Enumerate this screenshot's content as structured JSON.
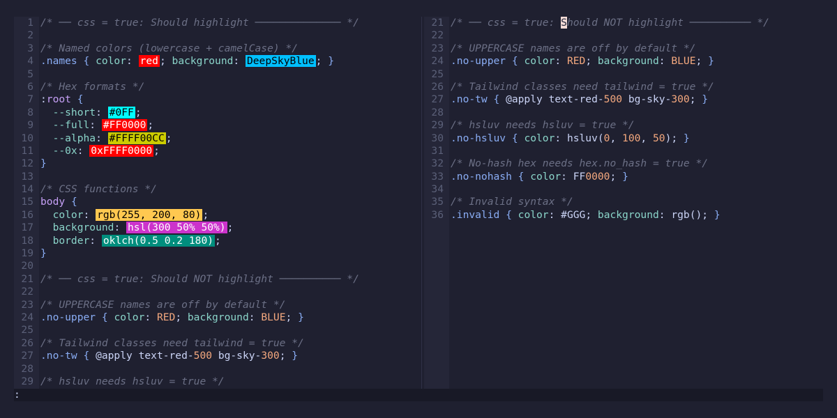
{
  "statusbar": {
    "text": ":"
  },
  "colors": {
    "red": "#ff0000",
    "deepskyblue": "#00bfff",
    "cyan": "#00ffff",
    "yellow_alpha": "#cccc00",
    "rgb_swatch": "#ffc850",
    "hsl_swatch": "#cc33cc",
    "oklch_swatch": "#008e7d"
  },
  "left": [
    {
      "n": "1",
      "segs": [
        {
          "t": "/* ── css = true: Should highlight ────────────── */",
          "c": "cmt"
        }
      ]
    },
    {
      "n": "2",
      "segs": []
    },
    {
      "n": "3",
      "segs": [
        {
          "t": "/* Named colors (lowercase + camelCase) */",
          "c": "cmt"
        }
      ]
    },
    {
      "n": "4",
      "segs": [
        {
          "t": ".names",
          "c": "sel"
        },
        {
          "t": " { ",
          "c": "punc"
        },
        {
          "t": "color",
          "c": "prop"
        },
        {
          "t": ": ",
          "c": "txt"
        },
        {
          "t": "red",
          "sw": "#ff0000",
          "fg": "#ffffff"
        },
        {
          "t": "; ",
          "c": "txt"
        },
        {
          "t": "background",
          "c": "prop"
        },
        {
          "t": ": ",
          "c": "txt"
        },
        {
          "t": "DeepSkyBlue",
          "sw": "#00bfff",
          "fg": "#000000"
        },
        {
          "t": "; ",
          "c": "txt"
        },
        {
          "t": "}",
          "c": "punc"
        }
      ]
    },
    {
      "n": "5",
      "segs": []
    },
    {
      "n": "6",
      "segs": [
        {
          "t": "/* Hex formats */",
          "c": "cmt"
        }
      ]
    },
    {
      "n": "7",
      "segs": [
        {
          "t": ":",
          "c": "txt"
        },
        {
          "t": "root",
          "c": "at"
        },
        {
          "t": " {",
          "c": "punc"
        }
      ]
    },
    {
      "n": "8",
      "segs": [
        {
          "t": "  --short",
          "c": "prop"
        },
        {
          "t": ": ",
          "c": "txt"
        },
        {
          "t": "#0FF",
          "sw": "#00ffff",
          "fg": "#000000"
        },
        {
          "t": ";",
          "c": "txt"
        }
      ]
    },
    {
      "n": "9",
      "segs": [
        {
          "t": "  --full",
          "c": "prop"
        },
        {
          "t": ": ",
          "c": "txt"
        },
        {
          "t": "#FF0000",
          "sw": "#ff0000",
          "fg": "#ffffff"
        },
        {
          "t": ";",
          "c": "txt"
        }
      ]
    },
    {
      "n": "10",
      "segs": [
        {
          "t": "  --alpha",
          "c": "prop"
        },
        {
          "t": ": ",
          "c": "txt"
        },
        {
          "t": "#FFFF00CC",
          "sw": "#cccc00",
          "fg": "#000000"
        },
        {
          "t": ";",
          "c": "txt"
        }
      ]
    },
    {
      "n": "11",
      "segs": [
        {
          "t": "  --0x",
          "c": "prop"
        },
        {
          "t": ": ",
          "c": "txt"
        },
        {
          "t": "0xFFFF0000",
          "sw": "#ff0000",
          "fg": "#ffffff"
        },
        {
          "t": ";",
          "c": "txt"
        }
      ]
    },
    {
      "n": "12",
      "segs": [
        {
          "t": "}",
          "c": "punc"
        }
      ]
    },
    {
      "n": "13",
      "segs": []
    },
    {
      "n": "14",
      "segs": [
        {
          "t": "/* CSS functions */",
          "c": "cmt"
        }
      ]
    },
    {
      "n": "15",
      "segs": [
        {
          "t": "body",
          "c": "at"
        },
        {
          "t": " {",
          "c": "punc"
        }
      ]
    },
    {
      "n": "16",
      "segs": [
        {
          "t": "  color",
          "c": "prop"
        },
        {
          "t": ": ",
          "c": "txt"
        },
        {
          "t": "rgb(255, 200, 80)",
          "sw": "#ffc850",
          "fg": "#000000"
        },
        {
          "t": ";",
          "c": "txt"
        }
      ]
    },
    {
      "n": "17",
      "segs": [
        {
          "t": "  background",
          "c": "prop"
        },
        {
          "t": ": ",
          "c": "txt"
        },
        {
          "t": "hsl(300 50% 50%)",
          "sw": "#cc33cc",
          "fg": "#ffffff"
        },
        {
          "t": ";",
          "c": "txt"
        }
      ]
    },
    {
      "n": "18",
      "segs": [
        {
          "t": "  border",
          "c": "prop"
        },
        {
          "t": ": ",
          "c": "txt"
        },
        {
          "t": "oklch(0.5 0.2 180)",
          "sw": "#008e7d",
          "fg": "#ffffff"
        },
        {
          "t": ";",
          "c": "txt"
        }
      ]
    },
    {
      "n": "19",
      "segs": [
        {
          "t": "}",
          "c": "punc"
        }
      ]
    },
    {
      "n": "20",
      "segs": []
    },
    {
      "n": "21",
      "segs": [
        {
          "t": "/* ── css = true: Should NOT highlight ────────── */",
          "c": "cmt"
        }
      ]
    },
    {
      "n": "22",
      "segs": []
    },
    {
      "n": "23",
      "segs": [
        {
          "t": "/* UPPERCASE names are off by default */",
          "c": "cmt"
        }
      ]
    },
    {
      "n": "24",
      "segs": [
        {
          "t": ".no-upper",
          "c": "sel"
        },
        {
          "t": " { ",
          "c": "punc"
        },
        {
          "t": "color",
          "c": "prop"
        },
        {
          "t": ": ",
          "c": "txt"
        },
        {
          "t": "RED",
          "c": "num"
        },
        {
          "t": "; ",
          "c": "txt"
        },
        {
          "t": "background",
          "c": "prop"
        },
        {
          "t": ": ",
          "c": "txt"
        },
        {
          "t": "BLUE",
          "c": "num"
        },
        {
          "t": "; ",
          "c": "txt"
        },
        {
          "t": "}",
          "c": "punc"
        }
      ]
    },
    {
      "n": "25",
      "segs": []
    },
    {
      "n": "26",
      "segs": [
        {
          "t": "/* Tailwind classes need tailwind = true */",
          "c": "cmt"
        }
      ]
    },
    {
      "n": "27",
      "segs": [
        {
          "t": ".no-tw",
          "c": "sel"
        },
        {
          "t": " { ",
          "c": "punc"
        },
        {
          "t": "@apply ",
          "c": "txt"
        },
        {
          "t": "text-red-",
          "c": "txt"
        },
        {
          "t": "500",
          "c": "num"
        },
        {
          "t": " bg-sky-",
          "c": "txt"
        },
        {
          "t": "300",
          "c": "num"
        },
        {
          "t": "; ",
          "c": "txt"
        },
        {
          "t": "}",
          "c": "punc"
        }
      ]
    },
    {
      "n": "28",
      "segs": []
    },
    {
      "n": "29",
      "segs": [
        {
          "t": "/* hsluv needs hsluv = true */",
          "c": "cmt"
        }
      ]
    }
  ],
  "right": [
    {
      "n": "21",
      "segs": [
        {
          "t": "/* ── css = true: ",
          "c": "cmt"
        },
        {
          "t": "S",
          "cursor": true
        },
        {
          "t": "hould NOT highlight ────────── */",
          "c": "cmt"
        }
      ]
    },
    {
      "n": "22",
      "segs": []
    },
    {
      "n": "23",
      "segs": [
        {
          "t": "/* UPPERCASE names are off by default */",
          "c": "cmt"
        }
      ]
    },
    {
      "n": "24",
      "segs": [
        {
          "t": ".no-upper",
          "c": "sel"
        },
        {
          "t": " { ",
          "c": "punc"
        },
        {
          "t": "color",
          "c": "prop"
        },
        {
          "t": ": ",
          "c": "txt"
        },
        {
          "t": "RED",
          "c": "num"
        },
        {
          "t": "; ",
          "c": "txt"
        },
        {
          "t": "background",
          "c": "prop"
        },
        {
          "t": ": ",
          "c": "txt"
        },
        {
          "t": "BLUE",
          "c": "num"
        },
        {
          "t": "; ",
          "c": "txt"
        },
        {
          "t": "}",
          "c": "punc"
        }
      ]
    },
    {
      "n": "25",
      "segs": []
    },
    {
      "n": "26",
      "segs": [
        {
          "t": "/* Tailwind classes need tailwind = true */",
          "c": "cmt"
        }
      ]
    },
    {
      "n": "27",
      "segs": [
        {
          "t": ".no-tw",
          "c": "sel"
        },
        {
          "t": " { ",
          "c": "punc"
        },
        {
          "t": "@apply ",
          "c": "txt"
        },
        {
          "t": "text-red-",
          "c": "txt"
        },
        {
          "t": "500",
          "c": "num"
        },
        {
          "t": " bg-sky-",
          "c": "txt"
        },
        {
          "t": "300",
          "c": "num"
        },
        {
          "t": "; ",
          "c": "txt"
        },
        {
          "t": "}",
          "c": "punc"
        }
      ]
    },
    {
      "n": "28",
      "segs": []
    },
    {
      "n": "29",
      "segs": [
        {
          "t": "/* hsluv needs hsluv = true */",
          "c": "cmt"
        }
      ]
    },
    {
      "n": "30",
      "segs": [
        {
          "t": ".no-hsluv",
          "c": "sel"
        },
        {
          "t": " { ",
          "c": "punc"
        },
        {
          "t": "color",
          "c": "prop"
        },
        {
          "t": ": ",
          "c": "txt"
        },
        {
          "t": "hsluv(",
          "c": "txt"
        },
        {
          "t": "0",
          "c": "num"
        },
        {
          "t": ", ",
          "c": "txt"
        },
        {
          "t": "100",
          "c": "num"
        },
        {
          "t": ", ",
          "c": "txt"
        },
        {
          "t": "50",
          "c": "num"
        },
        {
          "t": "); ",
          "c": "txt"
        },
        {
          "t": "}",
          "c": "punc"
        }
      ]
    },
    {
      "n": "31",
      "segs": []
    },
    {
      "n": "32",
      "segs": [
        {
          "t": "/* No-hash hex needs hex.no_hash = true */",
          "c": "cmt"
        }
      ]
    },
    {
      "n": "33",
      "segs": [
        {
          "t": ".no-nohash",
          "c": "sel"
        },
        {
          "t": " { ",
          "c": "punc"
        },
        {
          "t": "color",
          "c": "prop"
        },
        {
          "t": ": ",
          "c": "txt"
        },
        {
          "t": "FF",
          "c": "txt"
        },
        {
          "t": "0000",
          "c": "num"
        },
        {
          "t": "; ",
          "c": "txt"
        },
        {
          "t": "}",
          "c": "punc"
        }
      ]
    },
    {
      "n": "34",
      "segs": []
    },
    {
      "n": "35",
      "segs": [
        {
          "t": "/* Invalid syntax */",
          "c": "cmt"
        }
      ]
    },
    {
      "n": "36",
      "segs": [
        {
          "t": ".invalid",
          "c": "sel"
        },
        {
          "t": " { ",
          "c": "punc"
        },
        {
          "t": "color",
          "c": "prop"
        },
        {
          "t": ": ",
          "c": "txt"
        },
        {
          "t": "#GGG",
          "c": "txt"
        },
        {
          "t": "; ",
          "c": "txt"
        },
        {
          "t": "background",
          "c": "prop"
        },
        {
          "t": ": ",
          "c": "txt"
        },
        {
          "t": "rgb(); ",
          "c": "txt"
        },
        {
          "t": "}",
          "c": "punc"
        }
      ]
    }
  ]
}
